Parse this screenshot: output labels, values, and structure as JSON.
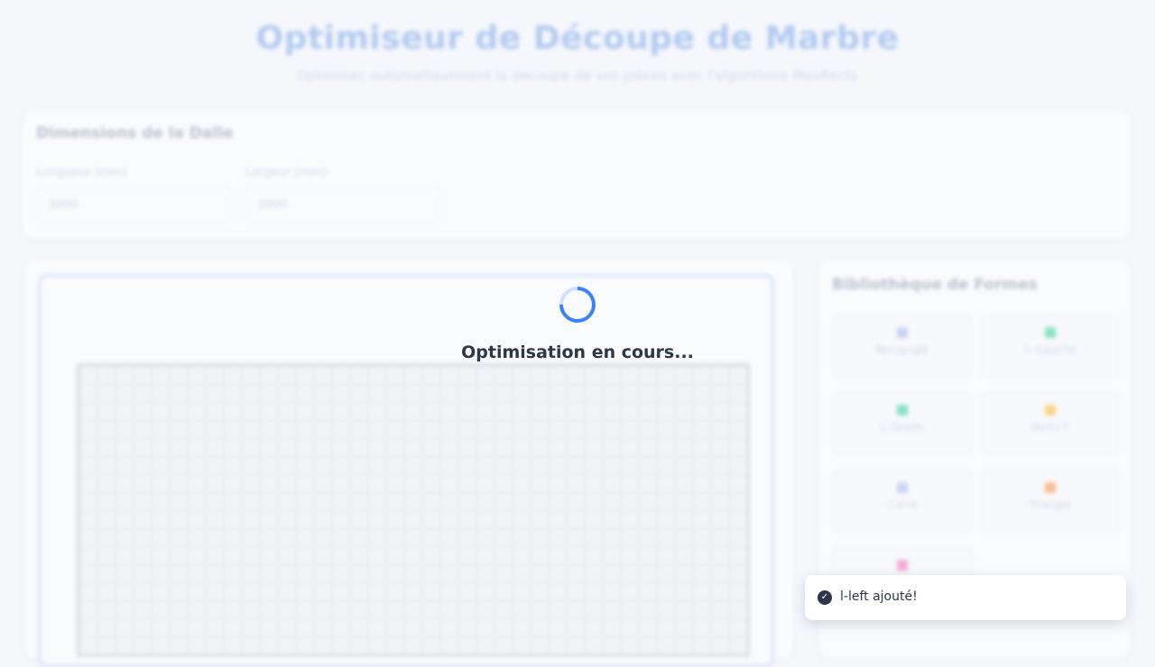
{
  "header": {
    "title": "Optimiseur de Découpe de Marbre",
    "subtitle": "Optimisez automatiquement la découpe de vos pièces avec l'algorithme MaxRects"
  },
  "dimensions": {
    "title": "Dimensions de la Dalle",
    "length_label": "Longueur (mm)",
    "length_value": "3000",
    "width_label": "Largeur (mm)",
    "width_value": "2000"
  },
  "library": {
    "title": "Bibliothèque de Formes",
    "shapes": [
      {
        "label": "Rectangle",
        "color": "#a8b8f0"
      },
      {
        "label": "L-Gauche",
        "color": "#34d399"
      },
      {
        "label": "L-Droite",
        "color": "#34d399"
      },
      {
        "label": "Demi-T",
        "color": "#fbbf24"
      },
      {
        "label": "Carré",
        "color": "#a8b8f0"
      },
      {
        "label": "Triangle",
        "color": "#fb923c"
      },
      {
        "label": "",
        "color": "#f472b6"
      }
    ]
  },
  "loading": {
    "text": "Optimisation en cours..."
  },
  "toast": {
    "message": "l-left ajouté!"
  },
  "colors": {
    "accent": "#3b82f6",
    "text": "#2d3748"
  }
}
